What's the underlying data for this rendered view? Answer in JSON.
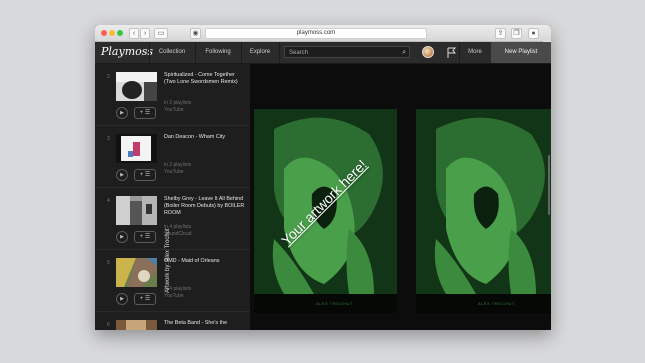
{
  "browser": {
    "url": "playmoss.com",
    "new_tab": "+"
  },
  "nav": {
    "logo": "Playmoss",
    "items": [
      "Collection",
      "Following",
      "Explore"
    ],
    "search_placeholder": "Search",
    "more": "More",
    "new_playlist": "New Playlist"
  },
  "tracks": [
    {
      "num": "2",
      "title": "Spiritualized - Come Together (Two Lone Swordsmen Remix)",
      "playlists": "in 2 playlists",
      "source": "YouTube"
    },
    {
      "num": "3",
      "title": "Dan Deacon - Wham City",
      "playlists": "in 2 playlists",
      "source": "YouTube"
    },
    {
      "num": "4",
      "title": "Shelby Grey - Leave It All Behind (Boiler Room Debuts) by BOILER ROOM",
      "playlists": "in 4 playlists",
      "source": "SoundCloud"
    },
    {
      "num": "5",
      "title": "OMD - Maid of Orleans",
      "playlists": "in 4 playlists",
      "source": "YouTube"
    },
    {
      "num": "6",
      "title": "The Beta Band - She's the",
      "playlists": "",
      "source": ""
    }
  ],
  "controls": {
    "play": "▶",
    "add": "+ ☰"
  },
  "artwork": {
    "banner": "Your artwork here!",
    "credit": "Artwork by: Alex Trochut",
    "caption_left": "ALEX TROCHUT",
    "caption_right": "ALEX TROCHUT"
  },
  "colors": {
    "nav_bg": "#2b2b2b",
    "sidebar_bg": "#1e1e1e",
    "poster_green": "#2f8f3a",
    "new_playlist_bg": "#4a4a4a"
  }
}
